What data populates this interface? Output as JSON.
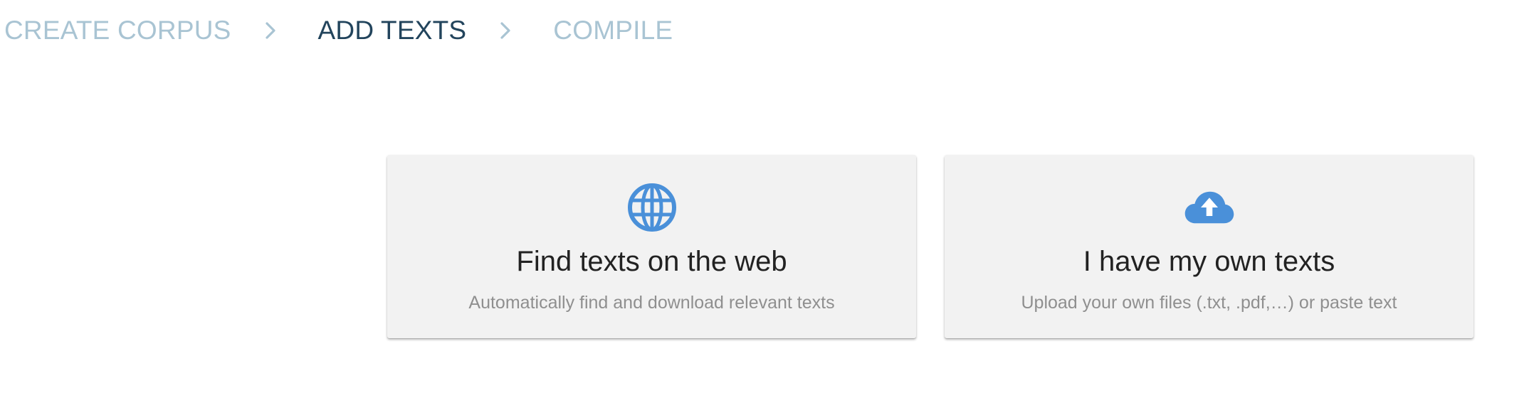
{
  "stepper": {
    "steps": [
      {
        "label": "CREATE CORPUS",
        "state": "inactive"
      },
      {
        "label": "ADD TEXTS",
        "state": "active"
      },
      {
        "label": "COMPILE",
        "state": "inactive"
      }
    ],
    "separator_icon": "chevron-right-icon"
  },
  "options": [
    {
      "icon": "globe-icon",
      "title": "Find texts on the web",
      "subtitle": "Automatically find and download relevant texts"
    },
    {
      "icon": "cloud-upload-icon",
      "title": "I have my own texts",
      "subtitle": "Upload your own files (.txt, .pdf,…) or paste text"
    }
  ],
  "colors": {
    "step_inactive": "#a9c4d3",
    "step_active": "#22445c",
    "icon_accent": "#4a90d9",
    "card_background": "#f2f2f2"
  }
}
